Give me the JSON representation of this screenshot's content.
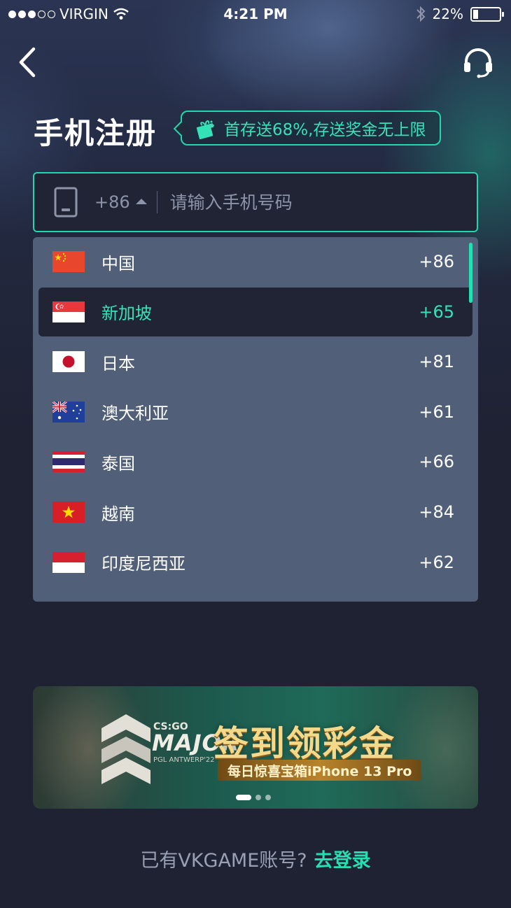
{
  "status_bar": {
    "carrier": "VIRGIN",
    "time": "4:21 PM",
    "battery": "22%",
    "battery_level": 0.22,
    "signal_bars": 3,
    "signal_total": 5
  },
  "nav": {
    "back_icon": "chevron-left-icon",
    "support_icon": "headset-icon"
  },
  "header": {
    "title": "手机注册",
    "promo": "首存送68%,存送奖金无上限",
    "promo_icon": "gift-icon"
  },
  "phone": {
    "country_code": "+86",
    "placeholder": "请输入手机号码",
    "value": ""
  },
  "countries": [
    {
      "name": "中国",
      "code": "+86",
      "flag": "cn",
      "selected": false
    },
    {
      "name": "新加坡",
      "code": "+65",
      "flag": "sg",
      "selected": true
    },
    {
      "name": "日本",
      "code": "+81",
      "flag": "jp",
      "selected": false
    },
    {
      "name": "澳大利亚",
      "code": "+61",
      "flag": "au",
      "selected": false
    },
    {
      "name": "泰国",
      "code": "+66",
      "flag": "th",
      "selected": false
    },
    {
      "name": "越南",
      "code": "+84",
      "flag": "vn",
      "selected": false
    },
    {
      "name": "印度尼西亚",
      "code": "+62",
      "flag": "id",
      "selected": false
    }
  ],
  "banner": {
    "logo_top": "CS:GO",
    "logo_main": "MAJOR",
    "logo_sub": "PGL ANTWERP'22",
    "title": "签到领彩金",
    "subtitle": "每日惊喜宝箱iPhone 13 Pro",
    "pages": 3,
    "active_page": 0
  },
  "footer": {
    "question": "已有VKGAME账号?",
    "login_link": "去登录"
  },
  "colors": {
    "accent": "#23d6ad",
    "background": "#1f2233",
    "dropdown": "#516078"
  }
}
